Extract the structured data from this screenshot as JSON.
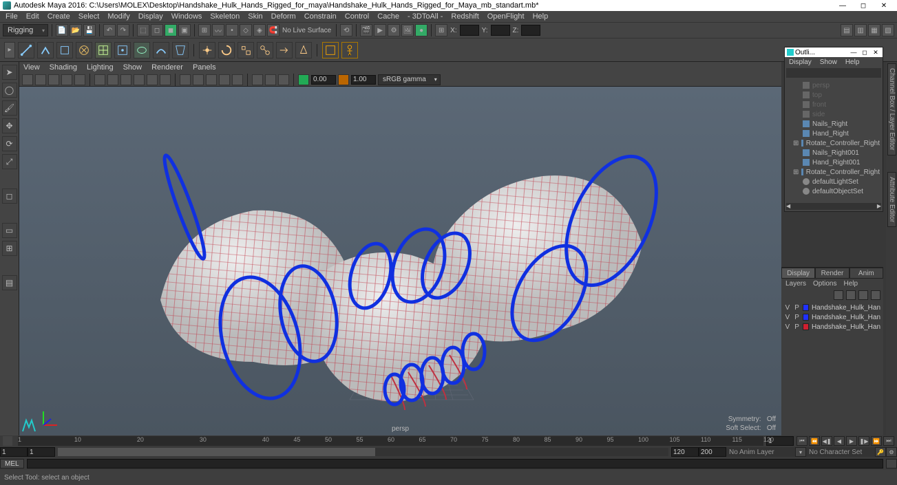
{
  "title": "Autodesk Maya 2016: C:\\Users\\MOLEX\\Desktop\\Handshake_Hulk_Hands_Rigged_for_maya\\Handshake_Hulk_Hands_Rigged_for_Maya_mb_standart.mb*",
  "menu": [
    "File",
    "Edit",
    "Create",
    "Select",
    "Modify",
    "Display",
    "Windows",
    "Skeleton",
    "Skin",
    "Deform",
    "Constrain",
    "Control",
    "Cache",
    "- 3DToAll -",
    "Redshift",
    "OpenFlight",
    "Help"
  ],
  "workspace": "Rigging",
  "nolive": "No Live Surface",
  "coords": {
    "x": "X:",
    "y": "Y:",
    "z": "Z:"
  },
  "panelMenu": [
    "View",
    "Shading",
    "Lighting",
    "Show",
    "Renderer",
    "Panels"
  ],
  "gamma": "1.00",
  "exposure": "0.00",
  "renderSpace": "sRGB gamma",
  "perspLabel": "persp",
  "hud": {
    "sym": "Symmetry:",
    "symv": "Off",
    "ss": "Soft Select:",
    "ssv": "Off"
  },
  "outliner": {
    "title": "Outli...",
    "menu": [
      "Display",
      "Show",
      "Help"
    ],
    "items": [
      {
        "name": "persp",
        "dim": true,
        "icon": "cam",
        "indent": 1
      },
      {
        "name": "top",
        "dim": true,
        "icon": "cam",
        "indent": 1
      },
      {
        "name": "front",
        "dim": true,
        "icon": "cam",
        "indent": 1
      },
      {
        "name": "side",
        "dim": true,
        "icon": "cam",
        "indent": 1
      },
      {
        "name": "Nails_Right",
        "icon": "mesh",
        "indent": 1
      },
      {
        "name": "Hand_Right",
        "icon": "mesh",
        "indent": 1
      },
      {
        "name": "Rotate_Controller_Right",
        "icon": "mesh",
        "indent": 1,
        "exp": true
      },
      {
        "name": "Nails_Right001",
        "icon": "mesh",
        "indent": 1
      },
      {
        "name": "Hand_Right001",
        "icon": "mesh",
        "indent": 1
      },
      {
        "name": "Rotate_Controller_Right",
        "icon": "mesh",
        "indent": 1,
        "exp": true
      },
      {
        "name": "defaultLightSet",
        "icon": "set",
        "indent": 1
      },
      {
        "name": "defaultObjectSet",
        "icon": "set",
        "indent": 1
      }
    ]
  },
  "layerTabs": [
    "Display",
    "Render",
    "Anim"
  ],
  "layerMenu": [
    "Layers",
    "Options",
    "Help"
  ],
  "layers": [
    {
      "v": "V",
      "p": "P",
      "color": "#2030ff",
      "name": "Handshake_Hulk_Hands_R"
    },
    {
      "v": "V",
      "p": "P",
      "color": "#2030ff",
      "name": "Handshake_Hulk_Hands_R"
    },
    {
      "v": "V",
      "p": "P",
      "color": "#d02030",
      "name": "Handshake_Hulk_Hands_R"
    }
  ],
  "timeline": {
    "ticks": [
      1,
      10,
      20,
      30,
      40,
      45,
      50,
      55,
      60,
      65,
      70,
      75,
      80,
      85,
      90,
      95,
      100,
      105,
      110,
      115,
      120
    ],
    "cur": "1",
    "start": "1",
    "rstart": "1",
    "rend": "120",
    "end": "120",
    "total": "200",
    "animLayer": "No Anim Layer",
    "charSet": "No Character Set"
  },
  "mel": "MEL",
  "status": "Select Tool: select an object",
  "rightTabs": [
    "Channel Box / Layer Editor",
    "Attribute Editor"
  ]
}
